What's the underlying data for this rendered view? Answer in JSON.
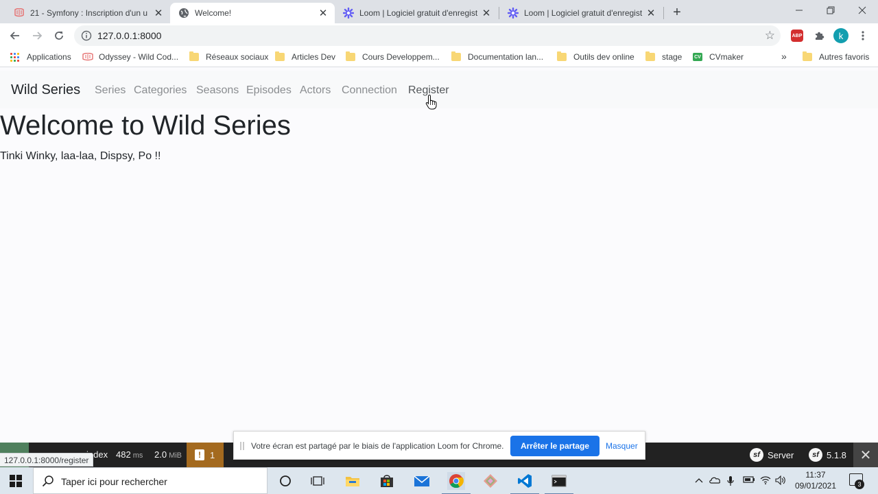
{
  "browser": {
    "tabs": [
      {
        "title": "21 - Symfony : Inscription d'un u",
        "favicon": "odyssey-icon",
        "active": false
      },
      {
        "title": "Welcome!",
        "favicon": "globe-icon",
        "active": true
      },
      {
        "title": "Loom | Logiciel gratuit d'enregist",
        "favicon": "loom-icon",
        "active": false
      },
      {
        "title": "Loom | Logiciel gratuit d'enregist",
        "favicon": "loom-icon",
        "active": false
      }
    ],
    "url": "127.0.0.1:8000",
    "bookmarks": [
      {
        "label": "Applications",
        "icon": "apps-grid-icon"
      },
      {
        "label": "Odyssey - Wild Cod...",
        "icon": "odyssey-icon"
      },
      {
        "label": "Réseaux sociaux",
        "icon": "folder-icon"
      },
      {
        "label": "Articles Dev",
        "icon": "folder-icon"
      },
      {
        "label": "Cours Developpem...",
        "icon": "folder-icon"
      },
      {
        "label": "Documentation lan...",
        "icon": "folder-icon"
      },
      {
        "label": "Outils dev online",
        "icon": "folder-icon"
      },
      {
        "label": "stage",
        "icon": "folder-icon"
      },
      {
        "label": "CVmaker",
        "icon": "cv-icon"
      },
      {
        "label": "Autres favoris",
        "icon": "folder-icon"
      }
    ],
    "bookmarks_overflow": "»",
    "profile_initial": "k",
    "status_url": "127.0.0.1:8000/register",
    "extension_abp_label": "ABP"
  },
  "site": {
    "brand": "Wild Series",
    "nav": [
      "Series",
      "Categories",
      "Seasons",
      "Episodes",
      "Actors",
      "Connection",
      "Register"
    ],
    "hovered_nav": "Register",
    "heading": "Welcome to Wild Series",
    "lead": "Tinki Winky, laa-laa, Dispsy, Po !!"
  },
  "symfony_toolbar": {
    "route": "index",
    "time_value": "482",
    "time_unit": "ms",
    "memory_value": "2.0",
    "memory_unit": "MiB",
    "warnings": "1",
    "server_label": "Server",
    "version": "5.1.8",
    "logo_text": "sf"
  },
  "loom_bar": {
    "message": "Votre écran est partagé par le biais de l'application Loom for Chrome.",
    "stop_label": "Arrêter le partage",
    "hide_label": "Masquer"
  },
  "taskbar": {
    "search_placeholder": "Taper ici pour rechercher",
    "time": "11:37",
    "date": "09/01/2021",
    "notification_count": "3"
  },
  "colors": {
    "navbar_bg": "#f8f9fa",
    "loom_button": "#1a73e8",
    "symfony_warning": "#a46a1f",
    "symfony_status": "#4f805d"
  }
}
